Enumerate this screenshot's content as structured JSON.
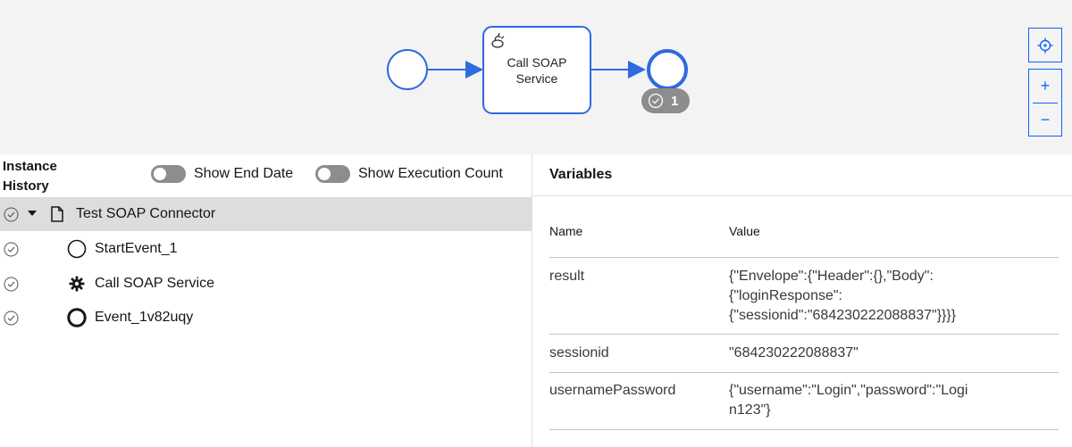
{
  "diagram": {
    "task_label_line1": "Call SOAP",
    "task_label_line2": "Service",
    "end_badge_count": "1"
  },
  "zoom_controls": {
    "recenter_icon": "crosshair-icon",
    "zoom_in_label": "+",
    "zoom_out_label": "−"
  },
  "instance_history": {
    "title_line1": "Instance",
    "title_line2": "History",
    "toggle_end_date": "Show End Date",
    "toggle_execution_count": "Show Execution Count",
    "rows": [
      {
        "label": "Test SOAP Connector",
        "icon": "document-icon"
      },
      {
        "label": "StartEvent_1",
        "icon": "start-event-icon"
      },
      {
        "label": "Call SOAP Service",
        "icon": "gear-icon"
      },
      {
        "label": "Event_1v82uqy",
        "icon": "end-event-icon"
      }
    ]
  },
  "variables": {
    "title": "Variables",
    "col_name": "Name",
    "col_value": "Value",
    "rows": [
      {
        "name": "result",
        "value_lines": [
          "{\"Envelope\":{\"Header\":{},\"Body\":",
          "{\"loginResponse\":",
          "{\"sessionid\":\"684230222088837\"}}}}"
        ]
      },
      {
        "name": "sessionid",
        "value_lines": [
          "\"684230222088837\""
        ]
      },
      {
        "name": "usernamePassword",
        "value_lines": [
          "{\"username\":\"Login\",\"password\":\"Logi",
          "n123\"}"
        ]
      }
    ]
  },
  "colors": {
    "accent": "#0f62fe",
    "bpmn_stroke": "#2e6ae0",
    "selected_row": "#dddddd",
    "canvas_bg": "#f3f3f3"
  }
}
